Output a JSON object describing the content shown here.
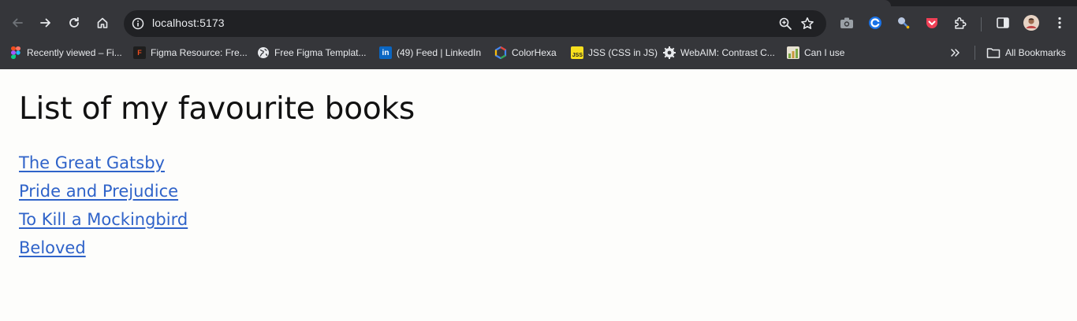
{
  "browser": {
    "address": "localhost:5173",
    "all_bookmarks_label": "All Bookmarks",
    "bookmarks": [
      {
        "label": "Recently viewed – Fi...",
        "icon": "figma-icon"
      },
      {
        "label": "Figma Resource: Fre...",
        "icon": "figma-resource-icon"
      },
      {
        "label": "Free Figma Templat...",
        "icon": "globe-icon"
      },
      {
        "label": "(49) Feed | LinkedIn",
        "icon": "linkedin-icon"
      },
      {
        "label": "ColorHexa",
        "icon": "colorhexa-icon"
      },
      {
        "label": "JSS (CSS in JS)",
        "icon": "jss-icon"
      },
      {
        "label": "WebAIM: Contrast C...",
        "icon": "webaim-icon"
      },
      {
        "label": "Can I use",
        "icon": "caniuse-icon"
      }
    ],
    "colors": {
      "toolbar_bg": "#35363a",
      "omnibox_bg": "#202124",
      "text": "#e8eaed"
    }
  },
  "page": {
    "title": "List of my favourite books",
    "books": [
      "The Great Gatsby",
      "Pride and Prejudice",
      "To Kill a Mockingbird",
      "Beloved"
    ],
    "colors": {
      "background": "#fdfdfb",
      "link": "#2f63c9"
    }
  }
}
